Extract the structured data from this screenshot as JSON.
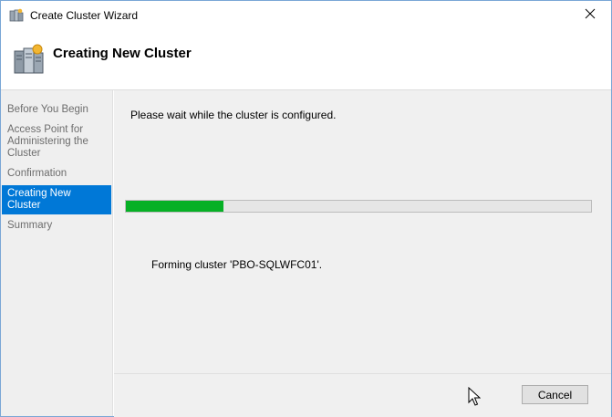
{
  "window": {
    "title": "Create Cluster Wizard",
    "close_icon": "close-icon"
  },
  "header": {
    "title": "Creating New Cluster",
    "icon": "cluster-servers-icon"
  },
  "sidebar": {
    "steps": [
      {
        "label": "Before You Begin",
        "active": false
      },
      {
        "label": "Access Point for Administering the Cluster",
        "active": false
      },
      {
        "label": "Confirmation",
        "active": false
      },
      {
        "label": "Creating New Cluster",
        "active": true
      },
      {
        "label": "Summary",
        "active": false
      }
    ]
  },
  "main": {
    "wait_text": "Please wait while the cluster is configured.",
    "progress_fraction": 0.21,
    "progress_color": "#06b025",
    "status_text": "Forming cluster 'PBO-SQLWFC01'."
  },
  "footer": {
    "cancel_label": "Cancel"
  },
  "colors": {
    "accent": "#0078d7"
  }
}
